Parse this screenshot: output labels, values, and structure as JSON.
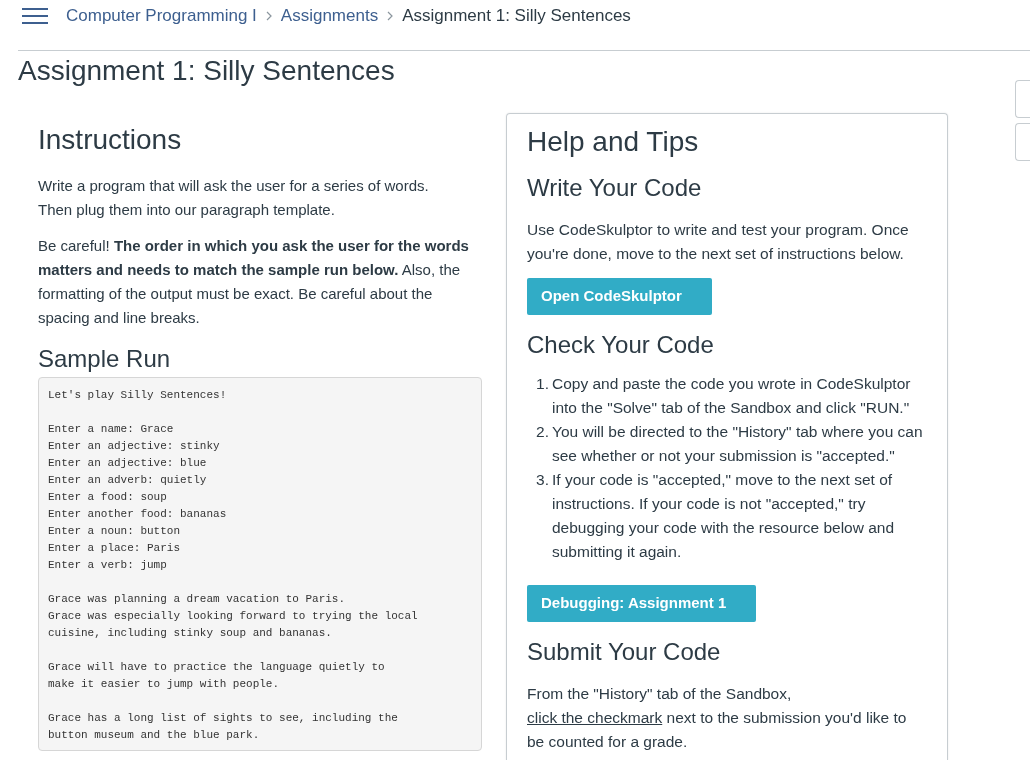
{
  "breadcrumb": [
    {
      "label": "Computer Programming I",
      "current": false
    },
    {
      "label": "Assignments",
      "current": false
    },
    {
      "label": "Assignment 1: Silly Sentences",
      "current": true
    }
  ],
  "page_title": "Assignment 1: Silly Sentences",
  "instructions": {
    "heading": "Instructions",
    "paragraphs": [
      "Write a program that will ask the user for a series of words. Then plug them into our paragraph template.",
      "Be careful! **The order in which you ask the user for the words matters and needs to match the sample run below.** Also, the formatting of the output must be exact. Be careful about the spacing and line breaks."
    ]
  },
  "sample_run": {
    "heading": "Sample Run",
    "output": "Let's play Silly Sentences!\n\nEnter a name: Grace\nEnter an adjective: stinky\nEnter an adjective: blue\nEnter an adverb: quietly\nEnter a food: soup\nEnter another food: bananas\nEnter a noun: button\nEnter a place: Paris\nEnter a verb: jump\n\nGrace was planning a dream vacation to Paris.\nGrace was especially looking forward to trying the local\ncuisine, including stinky soup and bananas.\n\nGrace will have to practice the language quietly to\nmake it easier to jump with people.\n\nGrace has a long list of sights to see, including the\nbutton museum and the blue park."
  },
  "help_panel": {
    "heading": "Help and Tips",
    "sections": [
      {
        "heading": "Write Your Code",
        "blocks": [
          {
            "kind": "paragraph",
            "parts": [
              {
                "text": "Use CodeSkulptor to write and test your program. Once you're done, move to the next set of instructions below."
              }
            ]
          },
          {
            "kind": "button",
            "label": "Open CodeSkulptor"
          }
        ]
      },
      {
        "heading": "Check Your Code",
        "blocks": [
          {
            "kind": "list",
            "items": [
              {
                "number": "1.",
                "text": "Copy and paste the code you wrote in CodeSkulptor into the \"Solve\" tab of the Sandbox and click \"RUN.\""
              },
              {
                "number": "2.",
                "text": "You will be directed to the \"History\" tab where you can see whether or not your submission is \"accepted.\""
              },
              {
                "number": "3.",
                "text": "If your code is \"accepted,\" move to the next set of instructions. If your code is not \"accepted,\" try debugging your code with the resource below and submitting it again."
              }
            ]
          },
          {
            "kind": "button",
            "label": "Debugging: Assignment 1"
          }
        ]
      },
      {
        "heading": "Submit Your Code",
        "blocks": [
          {
            "kind": "paragraph",
            "parts": [
              {
                "text": "From the \"History\" tab of the Sandbox, "
              },
              {
                "text": "click the checkmark",
                "link": true
              },
              {
                "text": " next to the submission you'd like to be counted for a grade."
              }
            ]
          }
        ]
      }
    ]
  }
}
